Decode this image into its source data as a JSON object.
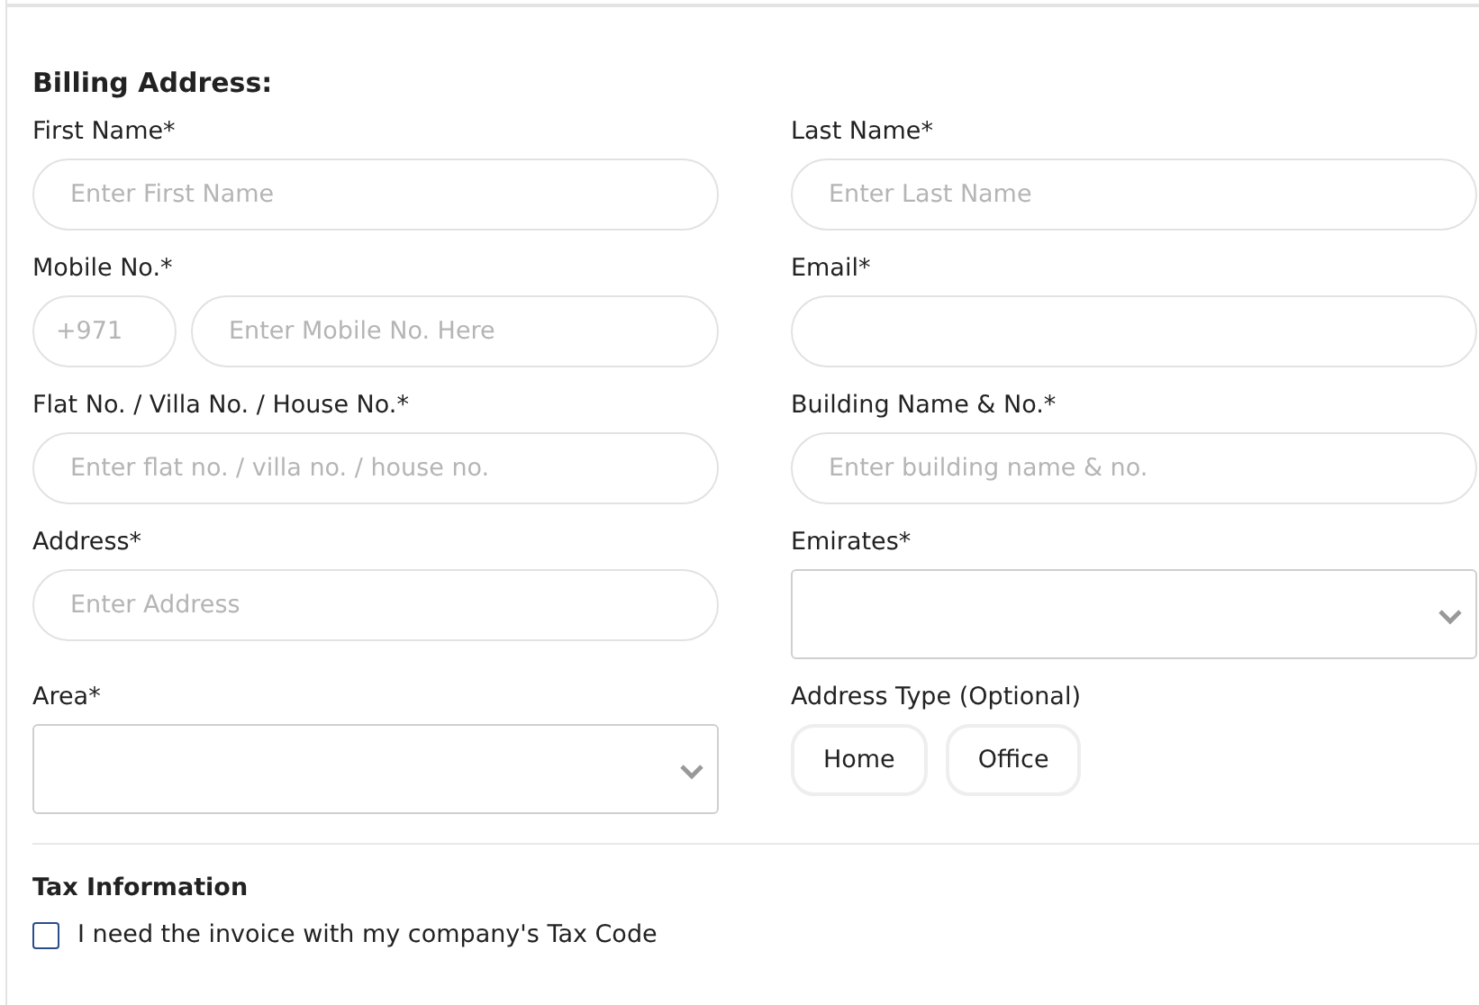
{
  "billing": {
    "title": "Billing Address:",
    "fields": [
      {
        "kind": "text",
        "label": "First Name*",
        "placeholder": "Enter First Name"
      },
      {
        "kind": "text",
        "label": "Last Name*",
        "placeholder": "Enter Last Name"
      },
      {
        "kind": "phone",
        "label": "Mobile No.*",
        "code_placeholder": "+971",
        "placeholder": "Enter Mobile No. Here"
      },
      {
        "kind": "text",
        "label": "Email*"
      },
      {
        "kind": "text",
        "label": "Flat No. / Villa No. / House No.*",
        "placeholder": "Enter flat no. / villa no. / house no."
      },
      {
        "kind": "text",
        "label": "Building Name & No.*",
        "placeholder": "Enter building name & no."
      },
      {
        "kind": "text",
        "label": "Address*",
        "placeholder": "Enter Address"
      },
      {
        "kind": "select",
        "label": "Emirates*"
      },
      {
        "kind": "select",
        "label": "Area*"
      },
      {
        "kind": "options",
        "label": "Address Type (Optional)",
        "options": [
          {
            "label": "Home",
            "selected": false
          },
          {
            "label": "Office",
            "selected": false
          }
        ]
      }
    ]
  },
  "tax": {
    "title": "Tax Information",
    "checkbox": {
      "label": "I need the invoice with my company's Tax Code",
      "checked": false
    }
  }
}
